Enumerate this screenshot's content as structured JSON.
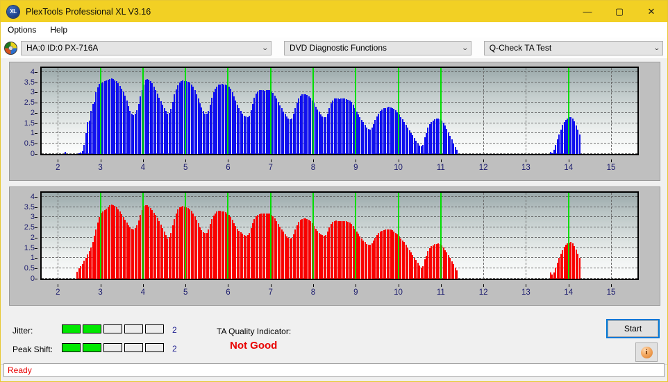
{
  "window": {
    "title": "PlexTools Professional XL V3.16",
    "logo_text": "XL",
    "minimize": "—",
    "maximize": "▢",
    "close": "✕"
  },
  "menu": {
    "items": [
      {
        "label": "Options"
      },
      {
        "label": "Help"
      }
    ]
  },
  "toolbar": {
    "drive_icon": "disc-icon",
    "drive": {
      "value": "HA:0 ID:0  PX-716A",
      "arrow": "⌄"
    },
    "function": {
      "value": "DVD Diagnostic Functions",
      "arrow": "⌄"
    },
    "test": {
      "value": "Q-Check TA Test",
      "arrow": "⌄"
    }
  },
  "indicators": {
    "jitter_label": "Jitter:",
    "jitter_value": "2",
    "jitter_segments": 5,
    "jitter_filled": 2,
    "peakshift_label": "Peak Shift:",
    "peakshift_value": "2",
    "peakshift_segments": 5,
    "peakshift_filled": 2,
    "ta_title": "TA Quality Indicator:",
    "ta_value": "Not Good",
    "ta_color": "#e80000",
    "meter_on_color": "#00e800"
  },
  "actions": {
    "start_label": "Start",
    "info_label": "i"
  },
  "status": {
    "text": "Ready",
    "color": "#e80000"
  },
  "chart_data": [
    {
      "type": "bar",
      "name": "TA Test Jitter (top)",
      "title": "",
      "xlabel": "",
      "ylabel": "",
      "color": "#1010ee",
      "xlim": [
        1.62,
        15.62
      ],
      "ylim": [
        0,
        4.2
      ],
      "yticks": [
        0,
        0.5,
        1,
        1.5,
        2,
        2.5,
        3,
        3.5,
        4
      ],
      "ytick_labels": [
        "0",
        "0.5",
        "1",
        "1.5",
        "2",
        "2.5",
        "3",
        "3.5",
        "4"
      ],
      "xticks": [
        2,
        3,
        4,
        5,
        6,
        7,
        8,
        9,
        10,
        11,
        12,
        13,
        14,
        15
      ],
      "xtick_labels": [
        "2",
        "3",
        "4",
        "5",
        "6",
        "7",
        "8",
        "9",
        "10",
        "11",
        "12",
        "13",
        "14",
        "15"
      ],
      "grid": true,
      "markers": [
        3,
        4,
        5,
        6,
        7,
        8,
        9,
        10,
        11,
        14
      ],
      "marker_color": "#00dd00",
      "x": [
        2.18,
        2.5,
        2.54,
        2.58,
        2.62,
        2.66,
        2.7,
        2.74,
        2.78,
        2.82,
        2.86,
        2.9,
        2.94,
        2.98,
        3.02,
        3.06,
        3.1,
        3.14,
        3.18,
        3.22,
        3.26,
        3.3,
        3.34,
        3.38,
        3.42,
        3.46,
        3.5,
        3.54,
        3.58,
        3.62,
        3.66,
        3.7,
        3.74,
        3.78,
        3.82,
        3.86,
        3.9,
        3.94,
        3.98,
        4.02,
        4.06,
        4.1,
        4.14,
        4.18,
        4.22,
        4.26,
        4.3,
        4.34,
        4.38,
        4.42,
        4.46,
        4.5,
        4.54,
        4.58,
        4.62,
        4.66,
        4.7,
        4.74,
        4.78,
        4.82,
        4.86,
        4.9,
        4.94,
        4.98,
        5.02,
        5.06,
        5.1,
        5.14,
        5.18,
        5.22,
        5.26,
        5.3,
        5.34,
        5.38,
        5.42,
        5.46,
        5.5,
        5.54,
        5.58,
        5.62,
        5.66,
        5.7,
        5.74,
        5.78,
        5.82,
        5.86,
        5.9,
        5.94,
        5.98,
        6.02,
        6.06,
        6.1,
        6.14,
        6.18,
        6.22,
        6.26,
        6.3,
        6.34,
        6.38,
        6.42,
        6.46,
        6.5,
        6.54,
        6.58,
        6.62,
        6.66,
        6.7,
        6.74,
        6.78,
        6.82,
        6.86,
        6.9,
        6.94,
        6.98,
        7.02,
        7.06,
        7.1,
        7.14,
        7.18,
        7.22,
        7.26,
        7.3,
        7.34,
        7.38,
        7.42,
        7.46,
        7.5,
        7.54,
        7.58,
        7.62,
        7.66,
        7.7,
        7.74,
        7.78,
        7.82,
        7.86,
        7.9,
        7.94,
        7.98,
        8.02,
        8.06,
        8.1,
        8.14,
        8.18,
        8.22,
        8.26,
        8.3,
        8.34,
        8.38,
        8.42,
        8.46,
        8.5,
        8.54,
        8.58,
        8.62,
        8.66,
        8.7,
        8.74,
        8.78,
        8.82,
        8.86,
        8.9,
        8.94,
        8.98,
        9.02,
        9.06,
        9.1,
        9.14,
        9.18,
        9.22,
        9.26,
        9.3,
        9.34,
        9.38,
        9.42,
        9.46,
        9.5,
        9.54,
        9.58,
        9.62,
        9.66,
        9.7,
        9.74,
        9.78,
        9.82,
        9.86,
        9.9,
        9.94,
        9.98,
        10.02,
        10.06,
        10.1,
        10.14,
        10.18,
        10.22,
        10.26,
        10.3,
        10.34,
        10.38,
        10.42,
        10.46,
        10.5,
        10.54,
        10.58,
        10.62,
        10.66,
        10.7,
        10.74,
        10.78,
        10.82,
        10.86,
        10.9,
        10.94,
        10.98,
        11.02,
        11.06,
        11.1,
        11.14,
        11.18,
        11.22,
        11.26,
        11.3,
        11.34,
        11.38,
        13.58,
        13.62,
        13.66,
        13.7,
        13.74,
        13.78,
        13.82,
        13.86,
        13.9,
        13.94,
        13.98,
        14.02,
        14.06,
        14.1,
        14.14,
        14.18,
        14.22,
        14.26
      ],
      "values": [
        0.1,
        0.05,
        0.08,
        0.12,
        0.45,
        1.0,
        1.55,
        1.62,
        2.1,
        2.45,
        2.55,
        3.0,
        3.25,
        3.42,
        3.45,
        3.48,
        3.55,
        3.58,
        3.62,
        3.65,
        3.68,
        3.66,
        3.6,
        3.55,
        3.45,
        3.32,
        3.2,
        3.05,
        2.85,
        2.6,
        2.35,
        2.1,
        1.95,
        1.9,
        1.95,
        2.15,
        2.45,
        2.8,
        3.1,
        3.4,
        3.62,
        3.65,
        3.62,
        3.55,
        3.45,
        3.3,
        3.12,
        2.95,
        2.75,
        2.58,
        2.4,
        2.25,
        2.1,
        1.98,
        2.0,
        2.2,
        2.55,
        2.9,
        3.15,
        3.35,
        3.5,
        3.55,
        3.58,
        3.56,
        3.55,
        3.52,
        3.48,
        3.4,
        3.28,
        3.12,
        2.92,
        2.7,
        2.48,
        2.28,
        2.1,
        1.98,
        1.95,
        2.1,
        2.4,
        2.75,
        3.0,
        3.18,
        3.3,
        3.38,
        3.4,
        3.42,
        3.4,
        3.38,
        3.35,
        3.3,
        3.18,
        3.0,
        2.82,
        2.62,
        2.42,
        2.25,
        2.1,
        1.98,
        1.88,
        1.82,
        1.8,
        1.88,
        2.12,
        2.45,
        2.75,
        2.95,
        3.05,
        3.1,
        3.12,
        3.1,
        3.08,
        3.1,
        3.12,
        3.1,
        3.05,
        2.98,
        2.85,
        2.7,
        2.55,
        2.38,
        2.22,
        2.08,
        1.95,
        1.82,
        1.72,
        1.68,
        1.72,
        1.95,
        2.25,
        2.52,
        2.72,
        2.85,
        2.9,
        2.92,
        2.9,
        2.88,
        2.82,
        2.75,
        2.62,
        2.48,
        2.32,
        2.18,
        2.05,
        1.92,
        1.82,
        1.78,
        1.8,
        1.98,
        2.25,
        2.48,
        2.62,
        2.7,
        2.72,
        2.7,
        2.68,
        2.7,
        2.72,
        2.7,
        2.68,
        2.65,
        2.62,
        2.55,
        2.42,
        2.25,
        2.08,
        1.92,
        1.78,
        1.65,
        1.55,
        1.42,
        1.3,
        1.22,
        1.2,
        1.28,
        1.45,
        1.65,
        1.82,
        1.98,
        2.1,
        2.18,
        2.22,
        2.25,
        2.28,
        2.3,
        2.28,
        2.25,
        2.2,
        2.12,
        2.02,
        1.92,
        1.8,
        1.68,
        1.55,
        1.42,
        1.28,
        1.15,
        1.02,
        0.9,
        0.78,
        0.65,
        0.52,
        0.42,
        0.38,
        0.45,
        0.82,
        1.0,
        1.28,
        1.45,
        1.55,
        1.62,
        1.68,
        1.72,
        1.74,
        1.7,
        1.62,
        1.52,
        1.38,
        1.22,
        1.05,
        0.88,
        0.7,
        0.52,
        0.35,
        0.2,
        0.1,
        0.05,
        0.22,
        0.45,
        0.7,
        0.95,
        1.2,
        1.42,
        1.55,
        1.65,
        1.72,
        1.78,
        1.8,
        1.72,
        1.58,
        1.4,
        1.18,
        0.95,
        0.72,
        0.5,
        0.6
      ]
    },
    {
      "type": "bar",
      "name": "TA Test Peak Shift (bottom)",
      "title": "",
      "xlabel": "",
      "ylabel": "",
      "color": "#f90000",
      "xlim": [
        1.62,
        15.62
      ],
      "ylim": [
        0,
        4.2
      ],
      "yticks": [
        0,
        0.5,
        1,
        1.5,
        2,
        2.5,
        3,
        3.5,
        4
      ],
      "ytick_labels": [
        "0",
        "0.5",
        "1",
        "1.5",
        "2",
        "2.5",
        "3",
        "3.5",
        "4"
      ],
      "xticks": [
        2,
        3,
        4,
        5,
        6,
        7,
        8,
        9,
        10,
        11,
        12,
        13,
        14,
        15
      ],
      "xtick_labels": [
        "2",
        "3",
        "4",
        "5",
        "6",
        "7",
        "8",
        "9",
        "10",
        "11",
        "12",
        "13",
        "14",
        "15"
      ],
      "grid": true,
      "markers": [
        3,
        4,
        5,
        6,
        7,
        8,
        9,
        10,
        11,
        14
      ],
      "marker_color": "#00dd00",
      "x": [
        2.46,
        2.5,
        2.54,
        2.58,
        2.62,
        2.66,
        2.7,
        2.74,
        2.78,
        2.82,
        2.86,
        2.9,
        2.94,
        2.98,
        3.02,
        3.06,
        3.1,
        3.14,
        3.18,
        3.22,
        3.26,
        3.3,
        3.34,
        3.38,
        3.42,
        3.46,
        3.5,
        3.54,
        3.58,
        3.62,
        3.66,
        3.7,
        3.74,
        3.78,
        3.82,
        3.86,
        3.9,
        3.94,
        3.98,
        4.02,
        4.06,
        4.1,
        4.14,
        4.18,
        4.22,
        4.26,
        4.3,
        4.34,
        4.38,
        4.42,
        4.46,
        4.5,
        4.54,
        4.58,
        4.62,
        4.66,
        4.7,
        4.74,
        4.78,
        4.82,
        4.86,
        4.9,
        4.94,
        4.98,
        5.02,
        5.06,
        5.1,
        5.14,
        5.18,
        5.22,
        5.26,
        5.3,
        5.34,
        5.38,
        5.42,
        5.46,
        5.5,
        5.54,
        5.58,
        5.62,
        5.66,
        5.7,
        5.74,
        5.78,
        5.82,
        5.86,
        5.9,
        5.94,
        5.98,
        6.02,
        6.06,
        6.1,
        6.14,
        6.18,
        6.22,
        6.26,
        6.3,
        6.34,
        6.38,
        6.42,
        6.46,
        6.5,
        6.54,
        6.58,
        6.62,
        6.66,
        6.7,
        6.74,
        6.78,
        6.82,
        6.86,
        6.9,
        6.94,
        6.98,
        7.02,
        7.06,
        7.1,
        7.14,
        7.18,
        7.22,
        7.26,
        7.3,
        7.34,
        7.38,
        7.42,
        7.46,
        7.5,
        7.54,
        7.58,
        7.62,
        7.66,
        7.7,
        7.74,
        7.78,
        7.82,
        7.86,
        7.9,
        7.94,
        7.98,
        8.02,
        8.06,
        8.1,
        8.14,
        8.18,
        8.22,
        8.26,
        8.3,
        8.34,
        8.38,
        8.42,
        8.46,
        8.5,
        8.54,
        8.58,
        8.62,
        8.66,
        8.7,
        8.74,
        8.78,
        8.82,
        8.86,
        8.9,
        8.94,
        8.98,
        9.02,
        9.06,
        9.1,
        9.14,
        9.18,
        9.22,
        9.26,
        9.3,
        9.34,
        9.38,
        9.42,
        9.46,
        9.5,
        9.54,
        9.58,
        9.62,
        9.66,
        9.7,
        9.74,
        9.78,
        9.82,
        9.86,
        9.9,
        9.94,
        9.98,
        10.02,
        10.06,
        10.1,
        10.14,
        10.18,
        10.22,
        10.26,
        10.3,
        10.34,
        10.38,
        10.42,
        10.46,
        10.5,
        10.54,
        10.58,
        10.62,
        10.66,
        10.7,
        10.74,
        10.78,
        10.82,
        10.86,
        10.9,
        10.94,
        10.98,
        11.02,
        11.06,
        11.1,
        11.14,
        11.18,
        11.22,
        11.26,
        11.3,
        11.34,
        11.38,
        13.58,
        13.62,
        13.66,
        13.7,
        13.74,
        13.78,
        13.82,
        13.86,
        13.9,
        13.94,
        13.98,
        14.02,
        14.06,
        14.1,
        14.14,
        14.18,
        14.22,
        14.26
      ],
      "values": [
        0.35,
        0.52,
        0.6,
        0.72,
        0.88,
        1.02,
        1.18,
        1.35,
        1.52,
        1.8,
        2.1,
        2.42,
        2.75,
        3.02,
        3.22,
        3.3,
        3.35,
        3.42,
        3.5,
        3.58,
        3.62,
        3.6,
        3.55,
        3.48,
        3.4,
        3.28,
        3.15,
        3.0,
        2.88,
        2.75,
        2.62,
        2.52,
        2.45,
        2.42,
        2.48,
        2.62,
        2.85,
        3.1,
        3.35,
        3.55,
        3.6,
        3.58,
        3.52,
        3.45,
        3.35,
        3.22,
        3.1,
        2.98,
        2.82,
        2.65,
        2.48,
        2.32,
        2.15,
        1.98,
        2.02,
        2.25,
        2.6,
        2.92,
        3.18,
        3.38,
        3.48,
        3.52,
        3.55,
        3.52,
        3.5,
        3.45,
        3.4,
        3.32,
        3.2,
        3.05,
        2.88,
        2.7,
        2.52,
        2.38,
        2.28,
        2.22,
        2.25,
        2.42,
        2.68,
        2.92,
        3.08,
        3.2,
        3.28,
        3.32,
        3.32,
        3.3,
        3.28,
        3.25,
        3.2,
        3.12,
        3.0,
        2.88,
        2.72,
        2.58,
        2.45,
        2.35,
        2.28,
        2.2,
        2.15,
        2.1,
        2.12,
        2.25,
        2.48,
        2.72,
        2.92,
        3.05,
        3.12,
        3.15,
        3.18,
        3.18,
        3.18,
        3.2,
        3.2,
        3.18,
        3.12,
        3.05,
        2.95,
        2.82,
        2.68,
        2.55,
        2.42,
        2.3,
        2.18,
        2.08,
        2.0,
        1.95,
        2.0,
        2.18,
        2.42,
        2.62,
        2.78,
        2.88,
        2.92,
        2.95,
        2.95,
        2.92,
        2.88,
        2.8,
        2.7,
        2.58,
        2.45,
        2.35,
        2.25,
        2.18,
        2.12,
        2.1,
        2.15,
        2.32,
        2.52,
        2.68,
        2.78,
        2.82,
        2.85,
        2.82,
        2.8,
        2.8,
        2.82,
        2.82,
        2.8,
        2.78,
        2.75,
        2.68,
        2.58,
        2.45,
        2.32,
        2.2,
        2.08,
        1.98,
        1.88,
        1.78,
        1.7,
        1.65,
        1.65,
        1.72,
        1.85,
        2.0,
        2.12,
        2.22,
        2.3,
        2.35,
        2.38,
        2.4,
        2.42,
        2.42,
        2.4,
        2.38,
        2.32,
        2.25,
        2.18,
        2.08,
        1.98,
        1.88,
        1.78,
        1.65,
        1.52,
        1.4,
        1.28,
        1.15,
        1.02,
        0.9,
        0.78,
        0.65,
        0.55,
        0.6,
        0.95,
        1.12,
        1.35,
        1.48,
        1.58,
        1.62,
        1.68,
        1.7,
        1.72,
        1.68,
        1.62,
        1.52,
        1.4,
        1.28,
        1.15,
        1.0,
        0.85,
        0.7,
        0.55,
        0.42,
        0.3,
        0.2,
        0.32,
        0.55,
        0.78,
        1.0,
        1.22,
        1.4,
        1.55,
        1.65,
        1.72,
        1.75,
        1.78,
        1.72,
        1.58,
        1.42,
        1.22,
        1.0,
        0.78,
        0.58,
        0.62
      ]
    }
  ]
}
